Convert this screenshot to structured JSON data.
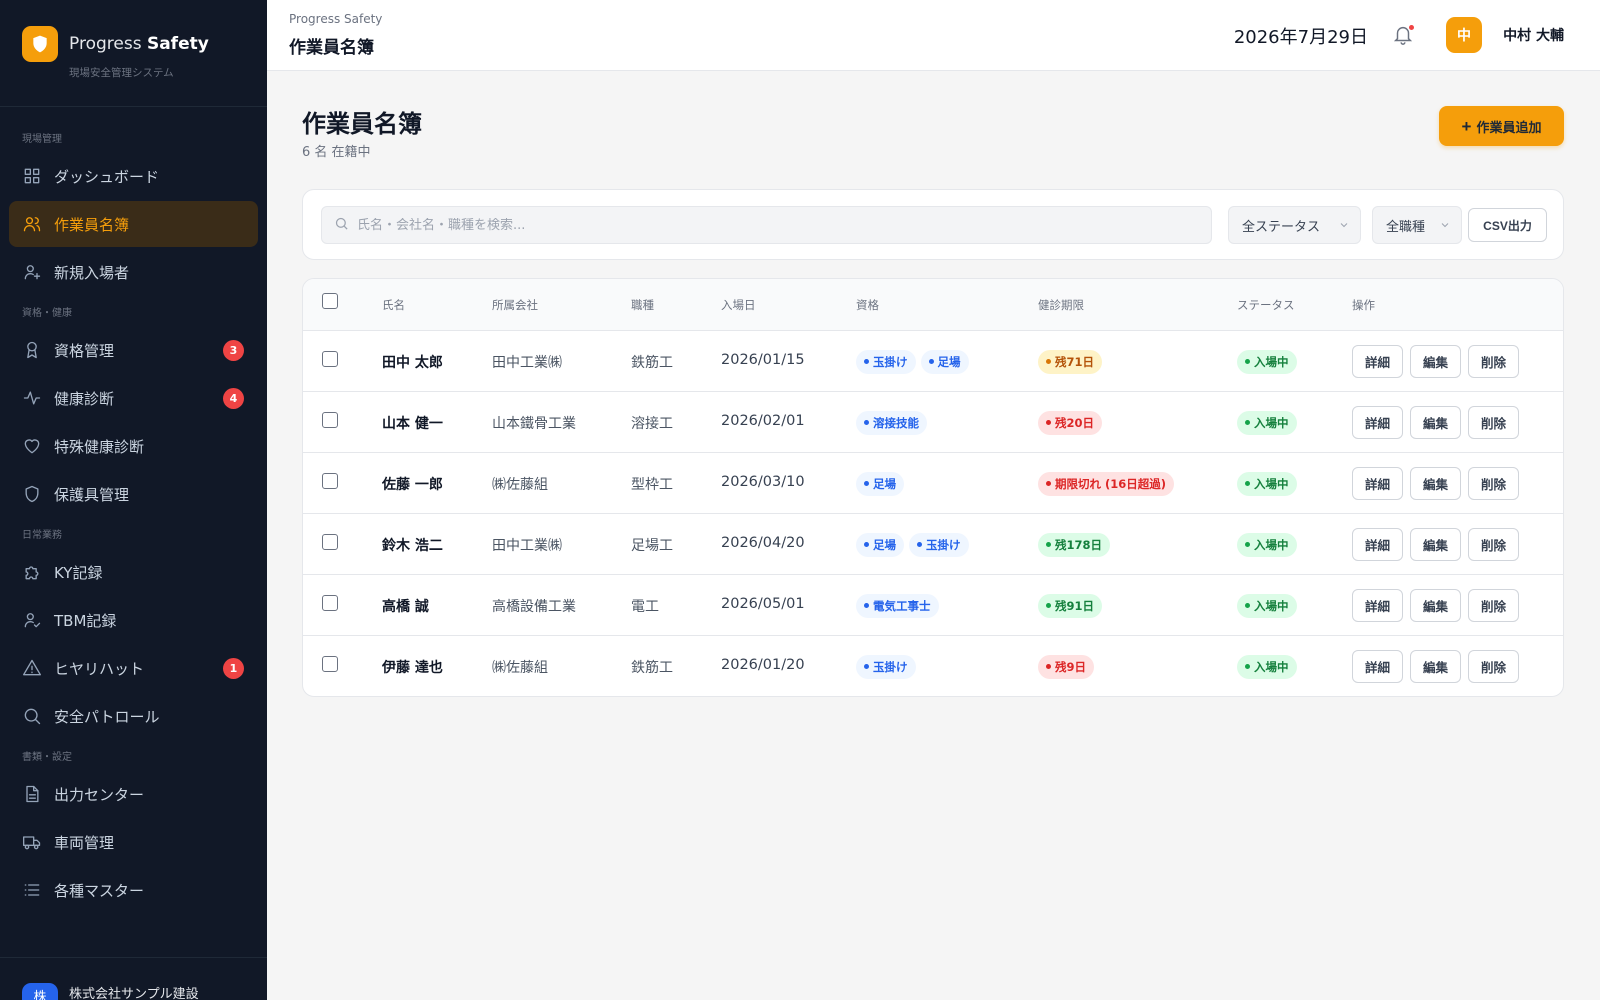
{
  "brand": {
    "name_prefix": "Progress",
    "name_bold": "Safety",
    "subtitle": "現場安全管理システム"
  },
  "sidebar": {
    "sections": [
      {
        "title": "現場管理",
        "items": [
          {
            "label": "ダッシュボード",
            "icon": "grid-icon",
            "active": false
          },
          {
            "label": "作業員名簿",
            "icon": "users-icon",
            "active": true
          },
          {
            "label": "新規入場者",
            "icon": "user-plus-icon",
            "active": false
          }
        ]
      },
      {
        "title": "資格・健康",
        "items": [
          {
            "label": "資格管理",
            "icon": "award-icon",
            "badge": "3"
          },
          {
            "label": "健康診断",
            "icon": "activity-icon",
            "badge": "4"
          },
          {
            "label": "特殊健康診断",
            "icon": "heart-icon"
          },
          {
            "label": "保護具管理",
            "icon": "shield-icon"
          }
        ]
      },
      {
        "title": "日常業務",
        "items": [
          {
            "label": "KY記録",
            "icon": "puzzle-icon"
          },
          {
            "label": "TBM記録",
            "icon": "user-check-icon"
          },
          {
            "label": "ヒヤリハット",
            "icon": "alert-triangle-icon",
            "badge": "1"
          },
          {
            "label": "安全パトロール",
            "icon": "search-icon"
          }
        ]
      },
      {
        "title": "書類・設定",
        "items": [
          {
            "label": "出力センター",
            "icon": "file-icon"
          },
          {
            "label": "車両管理",
            "icon": "truck-icon"
          },
          {
            "label": "各種マスター",
            "icon": "list-icon"
          }
        ]
      }
    ],
    "footer": {
      "avatar": "株",
      "company": "株式会社サンプル建設"
    }
  },
  "topbar": {
    "breadcrumb": "Progress Safety",
    "title": "作業員名簿",
    "date": "2026年7月29日",
    "user_initial": "中",
    "user_name": "中村 大輔"
  },
  "page": {
    "title": "作業員名簿",
    "subtitle": "6 名 在籍中",
    "add_button": "作業員追加"
  },
  "filters": {
    "search_placeholder": "氏名・会社名・職種を検索...",
    "status_select": "全ステータス",
    "job_select": "全職種",
    "csv_button": "CSV出力"
  },
  "table": {
    "headers": [
      "氏名",
      "所属会社",
      "職種",
      "入場日",
      "資格",
      "健診期限",
      "ステータス",
      "操作"
    ],
    "actions": [
      "詳細",
      "編集",
      "削除"
    ],
    "rows": [
      {
        "name": "田中 太郎",
        "company": "田中工業㈱",
        "job": "鉄筋工",
        "date": "2026/01/15",
        "quals": [
          "玉掛け",
          "足場"
        ],
        "checkup": "残71日",
        "checkup_level": "amber",
        "status": "入場中"
      },
      {
        "name": "山本 健一",
        "company": "山本鐵骨工業",
        "job": "溶接工",
        "date": "2026/02/01",
        "quals": [
          "溶接技能"
        ],
        "checkup": "残20日",
        "checkup_level": "red",
        "status": "入場中"
      },
      {
        "name": "佐藤 一郎",
        "company": "㈱佐藤組",
        "job": "型枠工",
        "date": "2026/03/10",
        "quals": [
          "足場"
        ],
        "checkup": "期限切れ (16日超過)",
        "checkup_level": "red",
        "status": "入場中"
      },
      {
        "name": "鈴木 浩二",
        "company": "田中工業㈱",
        "job": "足場工",
        "date": "2026/04/20",
        "quals": [
          "足場",
          "玉掛け"
        ],
        "checkup": "残178日",
        "checkup_level": "green",
        "status": "入場中"
      },
      {
        "name": "高橋 誠",
        "company": "高橋設備工業",
        "job": "電工",
        "date": "2026/05/01",
        "quals": [
          "電気工事士"
        ],
        "checkup": "残91日",
        "checkup_level": "green",
        "status": "入場中"
      },
      {
        "name": "伊藤 達也",
        "company": "㈱佐藤組",
        "job": "鉄筋工",
        "date": "2026/01/20",
        "quals": [
          "玉掛け"
        ],
        "checkup": "残9日",
        "checkup_level": "red",
        "status": "入場中"
      }
    ]
  },
  "colors": {
    "accent": "#f59e0b",
    "sidebar_bg": "#111827",
    "danger": "#ef4444"
  }
}
